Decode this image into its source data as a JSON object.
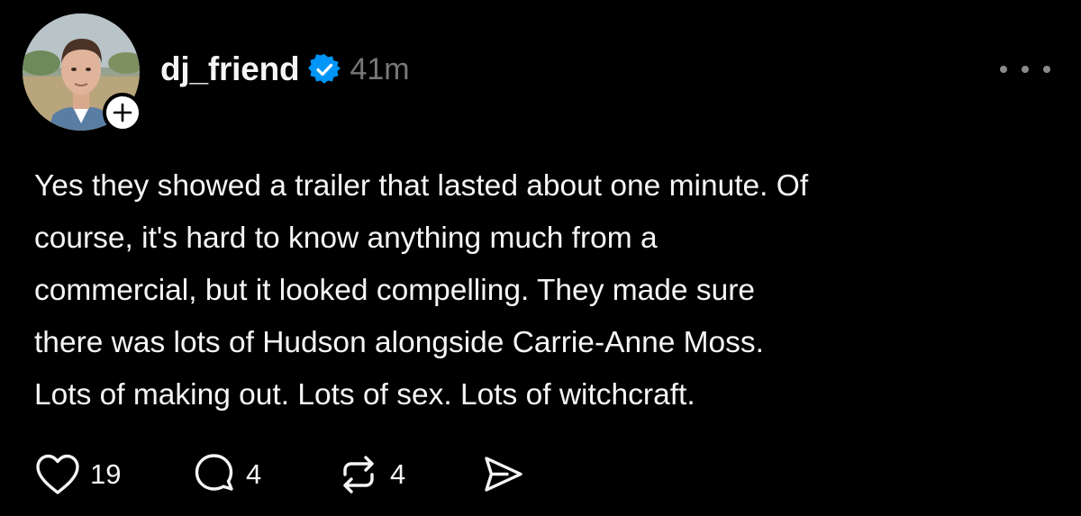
{
  "post": {
    "author": {
      "username": "dj_friend",
      "verified": true,
      "avatar": "profile-photo",
      "follow_badge": "+"
    },
    "time_ago": "41m",
    "text": "Yes they showed a trailer that lasted about one minute. Of\ncourse, it's hard to know anything much from a\ncommercial, but it looked compelling. They made sure\nthere was lots of Hudson alongside Carrie-Anne Moss.\nLots of making out. Lots of sex. Lots of witchcraft.",
    "actions": {
      "like_count": "19",
      "reply_count": "4",
      "repost_count": "4"
    }
  },
  "colors": {
    "background": "#000000",
    "text_primary": "#f3f5f7",
    "text_secondary": "#777777",
    "verified_blue": "#0095f6"
  },
  "icons": {
    "verified": "verified-badge-icon",
    "more": "more-options-icon",
    "like": "heart-icon",
    "reply": "comment-bubble-icon",
    "repost": "repost-icon",
    "share": "send-icon"
  }
}
